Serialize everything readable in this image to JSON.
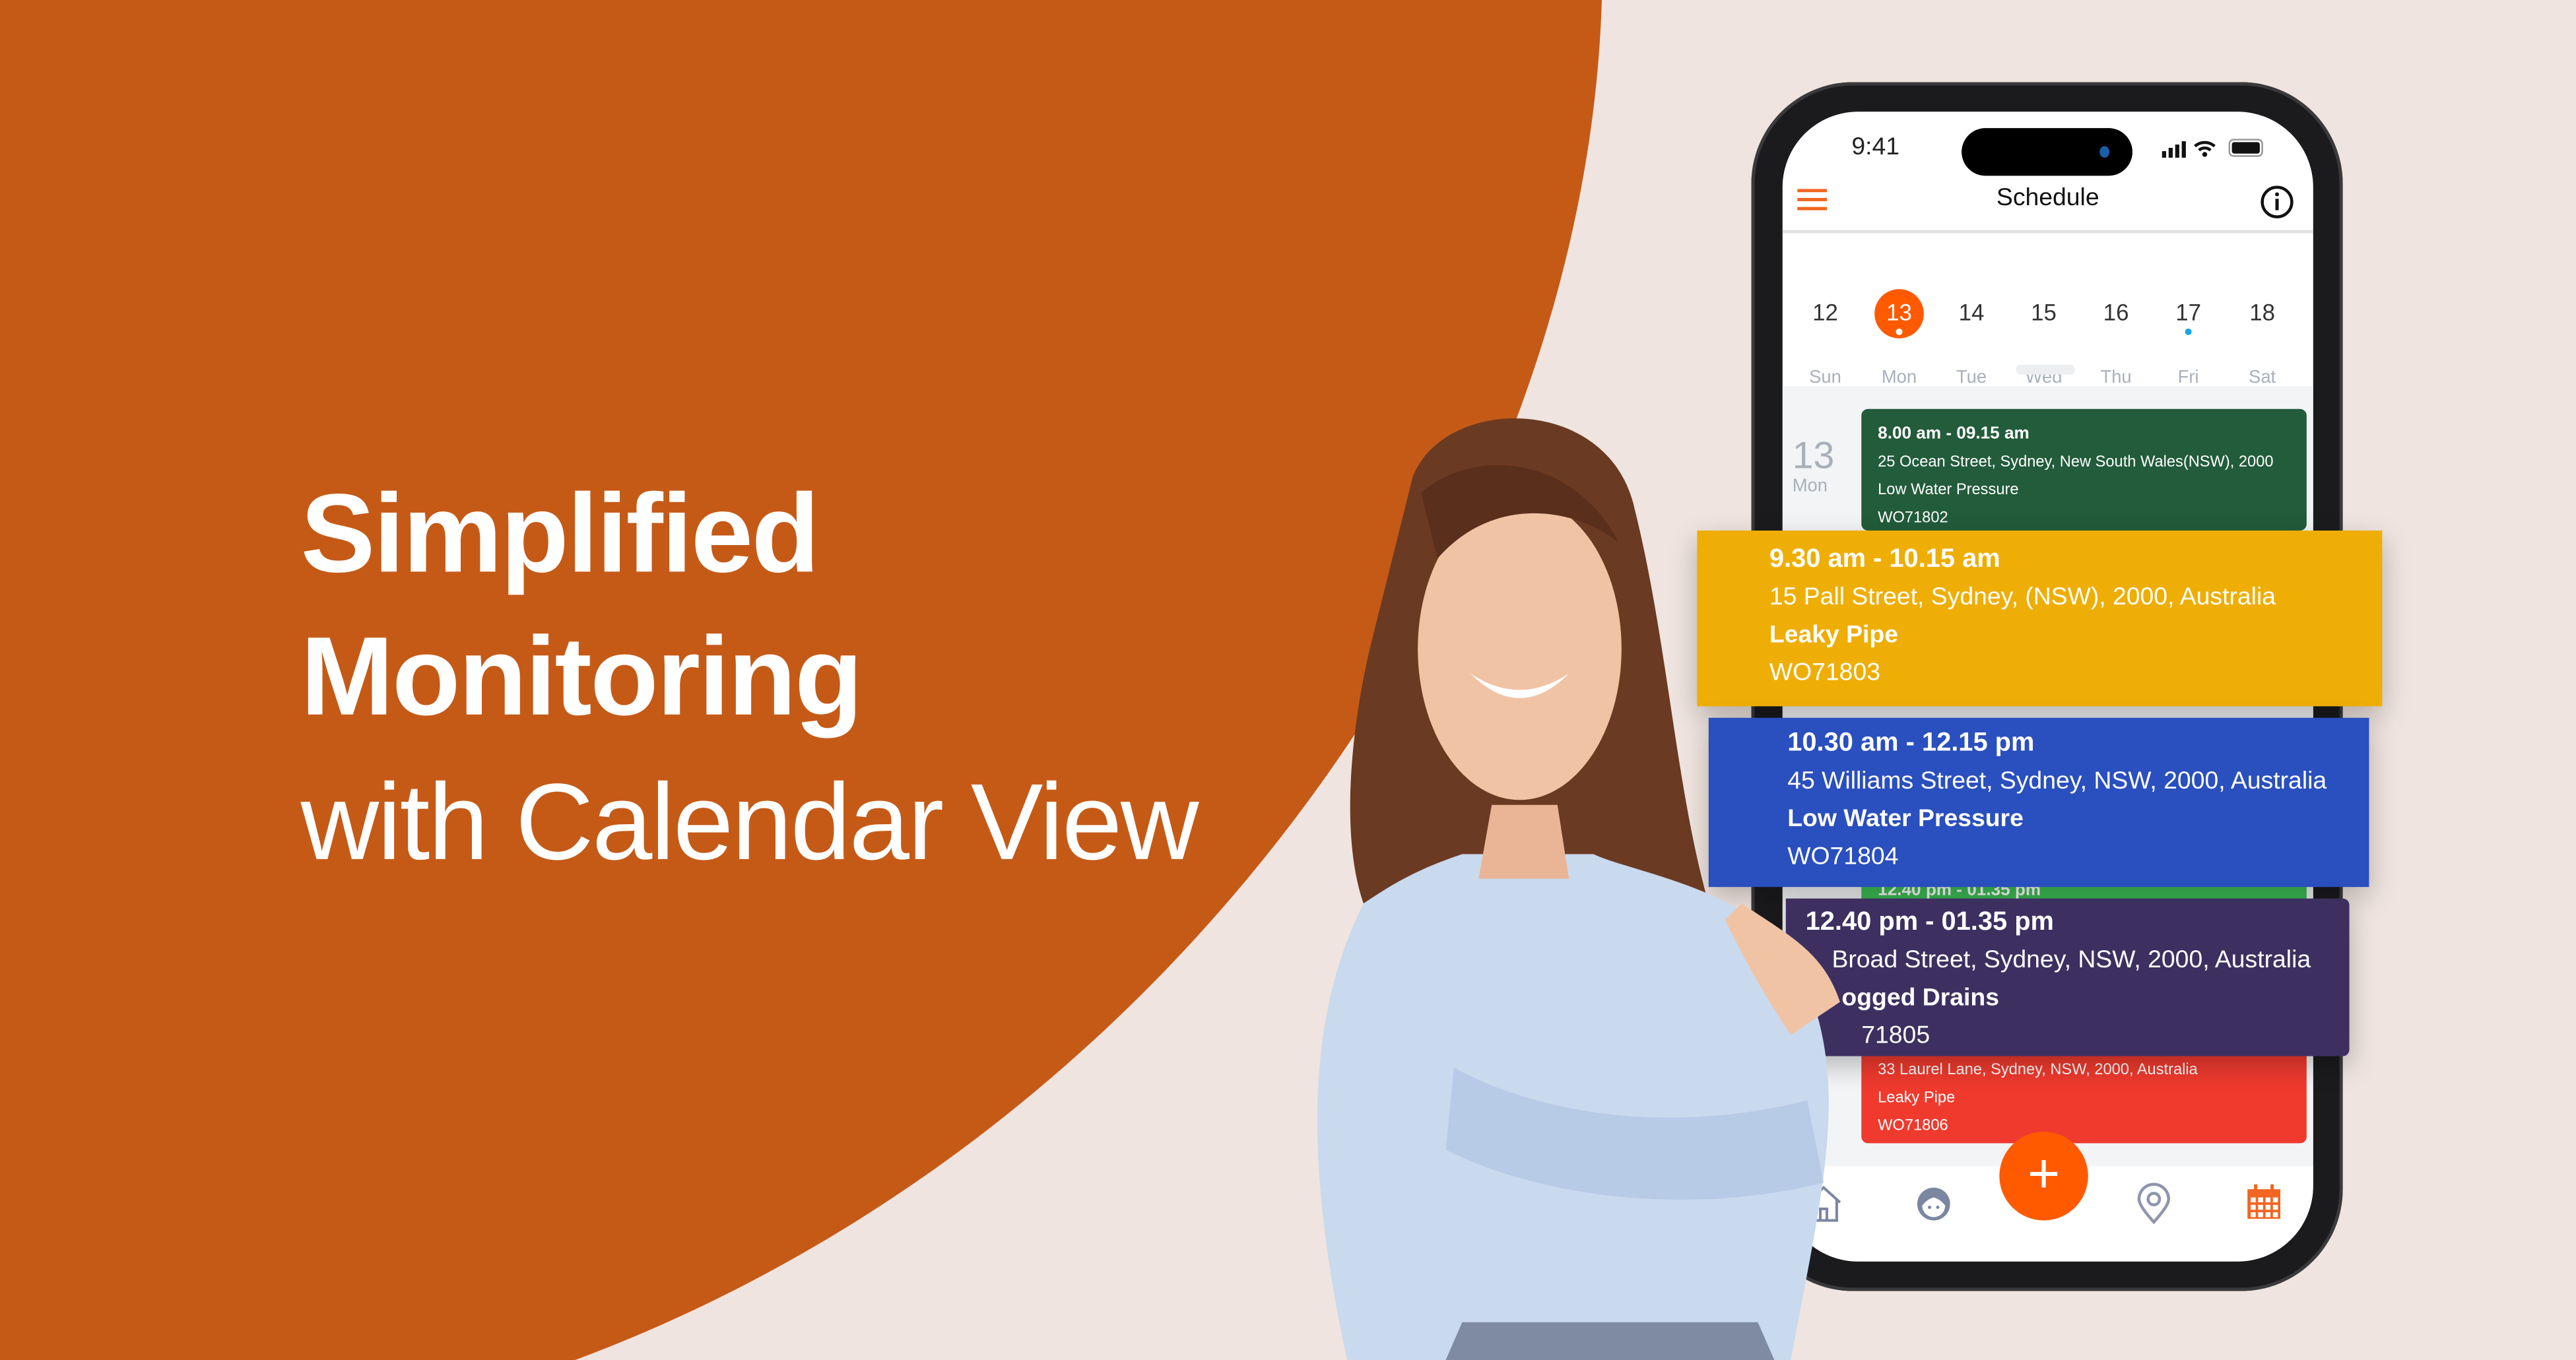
{
  "hero": {
    "line1": "Simplified",
    "line2": "Monitoring",
    "line3": "with Calendar View"
  },
  "colors": {
    "brand_orange": "#C55A17",
    "background": "#EFE4DF",
    "accent": "#FF5A00"
  },
  "status_bar": {
    "time": "9:41"
  },
  "header": {
    "title": "Schedule",
    "menu_icon": "hamburger-icon",
    "info_icon": "info-icon"
  },
  "week": {
    "days": [
      "Sun",
      "Mon",
      "Tue",
      "Wed",
      "Thu",
      "Fri",
      "Sat"
    ],
    "dates": [
      "12",
      "13",
      "14",
      "15",
      "16",
      "17",
      "18"
    ],
    "selected": "13"
  },
  "day_label": {
    "date": "13",
    "weekday": "Mon"
  },
  "appointments": [
    {
      "time": "8.00 am - 09.15 am",
      "address": "25 Ocean Street, Sydney, New South Wales(NSW), 2000",
      "issue": "Low Water Pressure",
      "id": "WO71802",
      "color": "#225C3A"
    },
    {
      "time": "9.30 am - 10.15 am",
      "address": "15 Pall Street, Sydney, (NSW), 2000, Australia",
      "issue": "Leaky Pipe",
      "id": "WO71803",
      "color": "#EEAE05"
    },
    {
      "time": "10.30 am - 12.15 pm",
      "address": "45 Williams Street, Sydney, NSW, 2000, Australia",
      "issue": "Low Water Pressure",
      "id": "WO71804",
      "color": "#2A4FBE"
    },
    {
      "time": "12.40 pm - 01.35 pm",
      "address": "Broad Street, Sydney, NSW,  2000, Australia",
      "issue": "ogged Drains",
      "id": "71805",
      "color": "#3D3060"
    },
    {
      "address": "33 Laurel Lane, Sydney, NSW, 2000, Australia",
      "issue": "Leaky Pipe",
      "id": "WO71806",
      "color": "#F03A2E"
    }
  ],
  "behind_card": {
    "time": "12.40 pm - 01.35 pm",
    "color": "#3DBE55"
  },
  "bottom_nav": [
    "home-icon",
    "profile-icon",
    "add-icon",
    "location-icon",
    "calendar-icon"
  ]
}
